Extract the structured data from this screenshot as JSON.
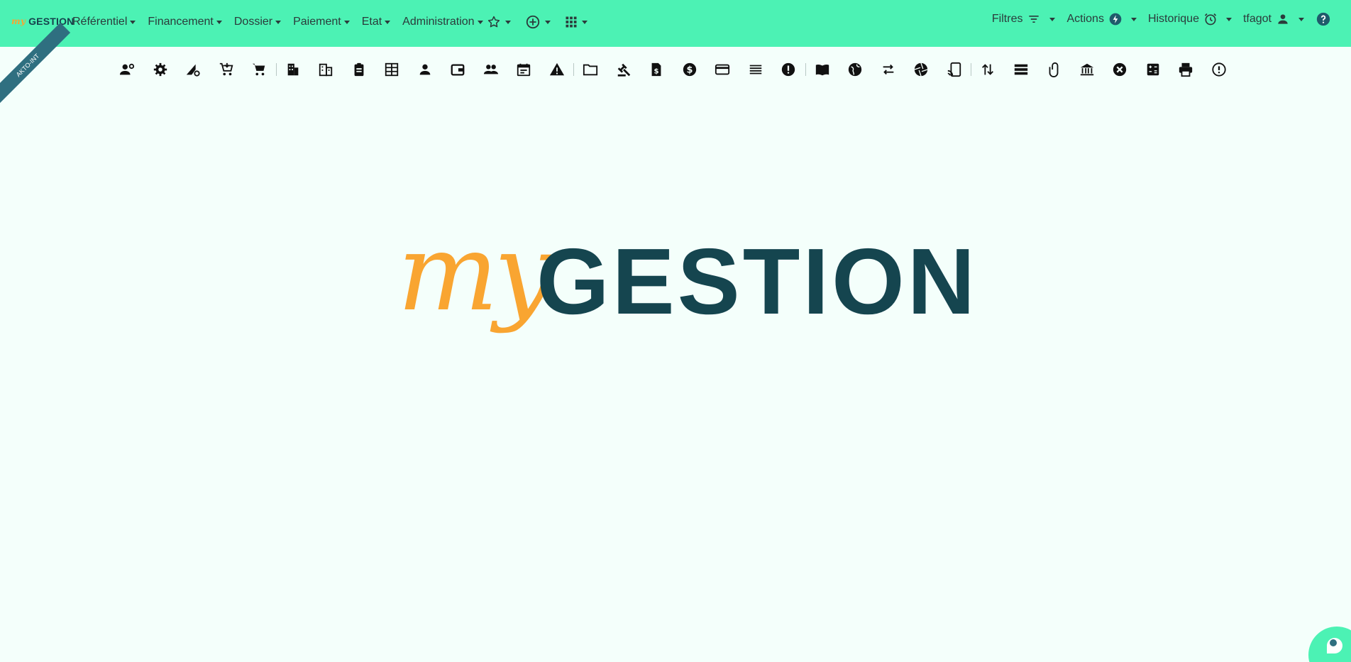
{
  "brand": {
    "my": "my",
    "name": "GESTION"
  },
  "menu": [
    {
      "label": "Référentiel"
    },
    {
      "label": "Financement"
    },
    {
      "label": "Dossier"
    },
    {
      "label": "Paiement"
    },
    {
      "label": "Etat"
    },
    {
      "label": "Administration"
    }
  ],
  "nav_icons": [
    "star-icon",
    "add-circle-icon",
    "apps-grid-icon"
  ],
  "right_menu": {
    "filters_label": "Filtres",
    "actions_label": "Actions",
    "history_label": "Historique",
    "user_label": "tfagot"
  },
  "ribbon_label": "AKTO-INT",
  "toolbar_icons": [
    "user-settings-icon",
    "gear-icon",
    "signal-settings-icon",
    "cart-arrow-icon",
    "cart-icon",
    "|",
    "building-icon",
    "office-building-icon",
    "clipboard-icon",
    "company-icon",
    "person-icon",
    "wallet-icon",
    "people-icon",
    "calendar-icon",
    "warning-icon",
    "|",
    "folder-icon",
    "gavel-icon",
    "invoice-icon",
    "dollar-icon",
    "credit-card-icon",
    "list-icon",
    "exclamation-icon",
    "|",
    "book-icon",
    "globe-icon",
    "transfer-icon",
    "aperture-icon",
    "cast-icon",
    "|",
    "swap-vertical-icon",
    "storage-icon",
    "attachment-icon",
    "bank-icon",
    "cancel-icon",
    "calculator-icon",
    "printer-icon",
    "alert-circle-icon"
  ],
  "logo": {
    "script": "my",
    "word": "GESTION"
  },
  "colors": {
    "navbar": "#4cf2b4",
    "background": "#f4fffb",
    "logo_orange": "#f9a531",
    "logo_teal": "#15454f",
    "ribbon": "#2f6f80"
  }
}
